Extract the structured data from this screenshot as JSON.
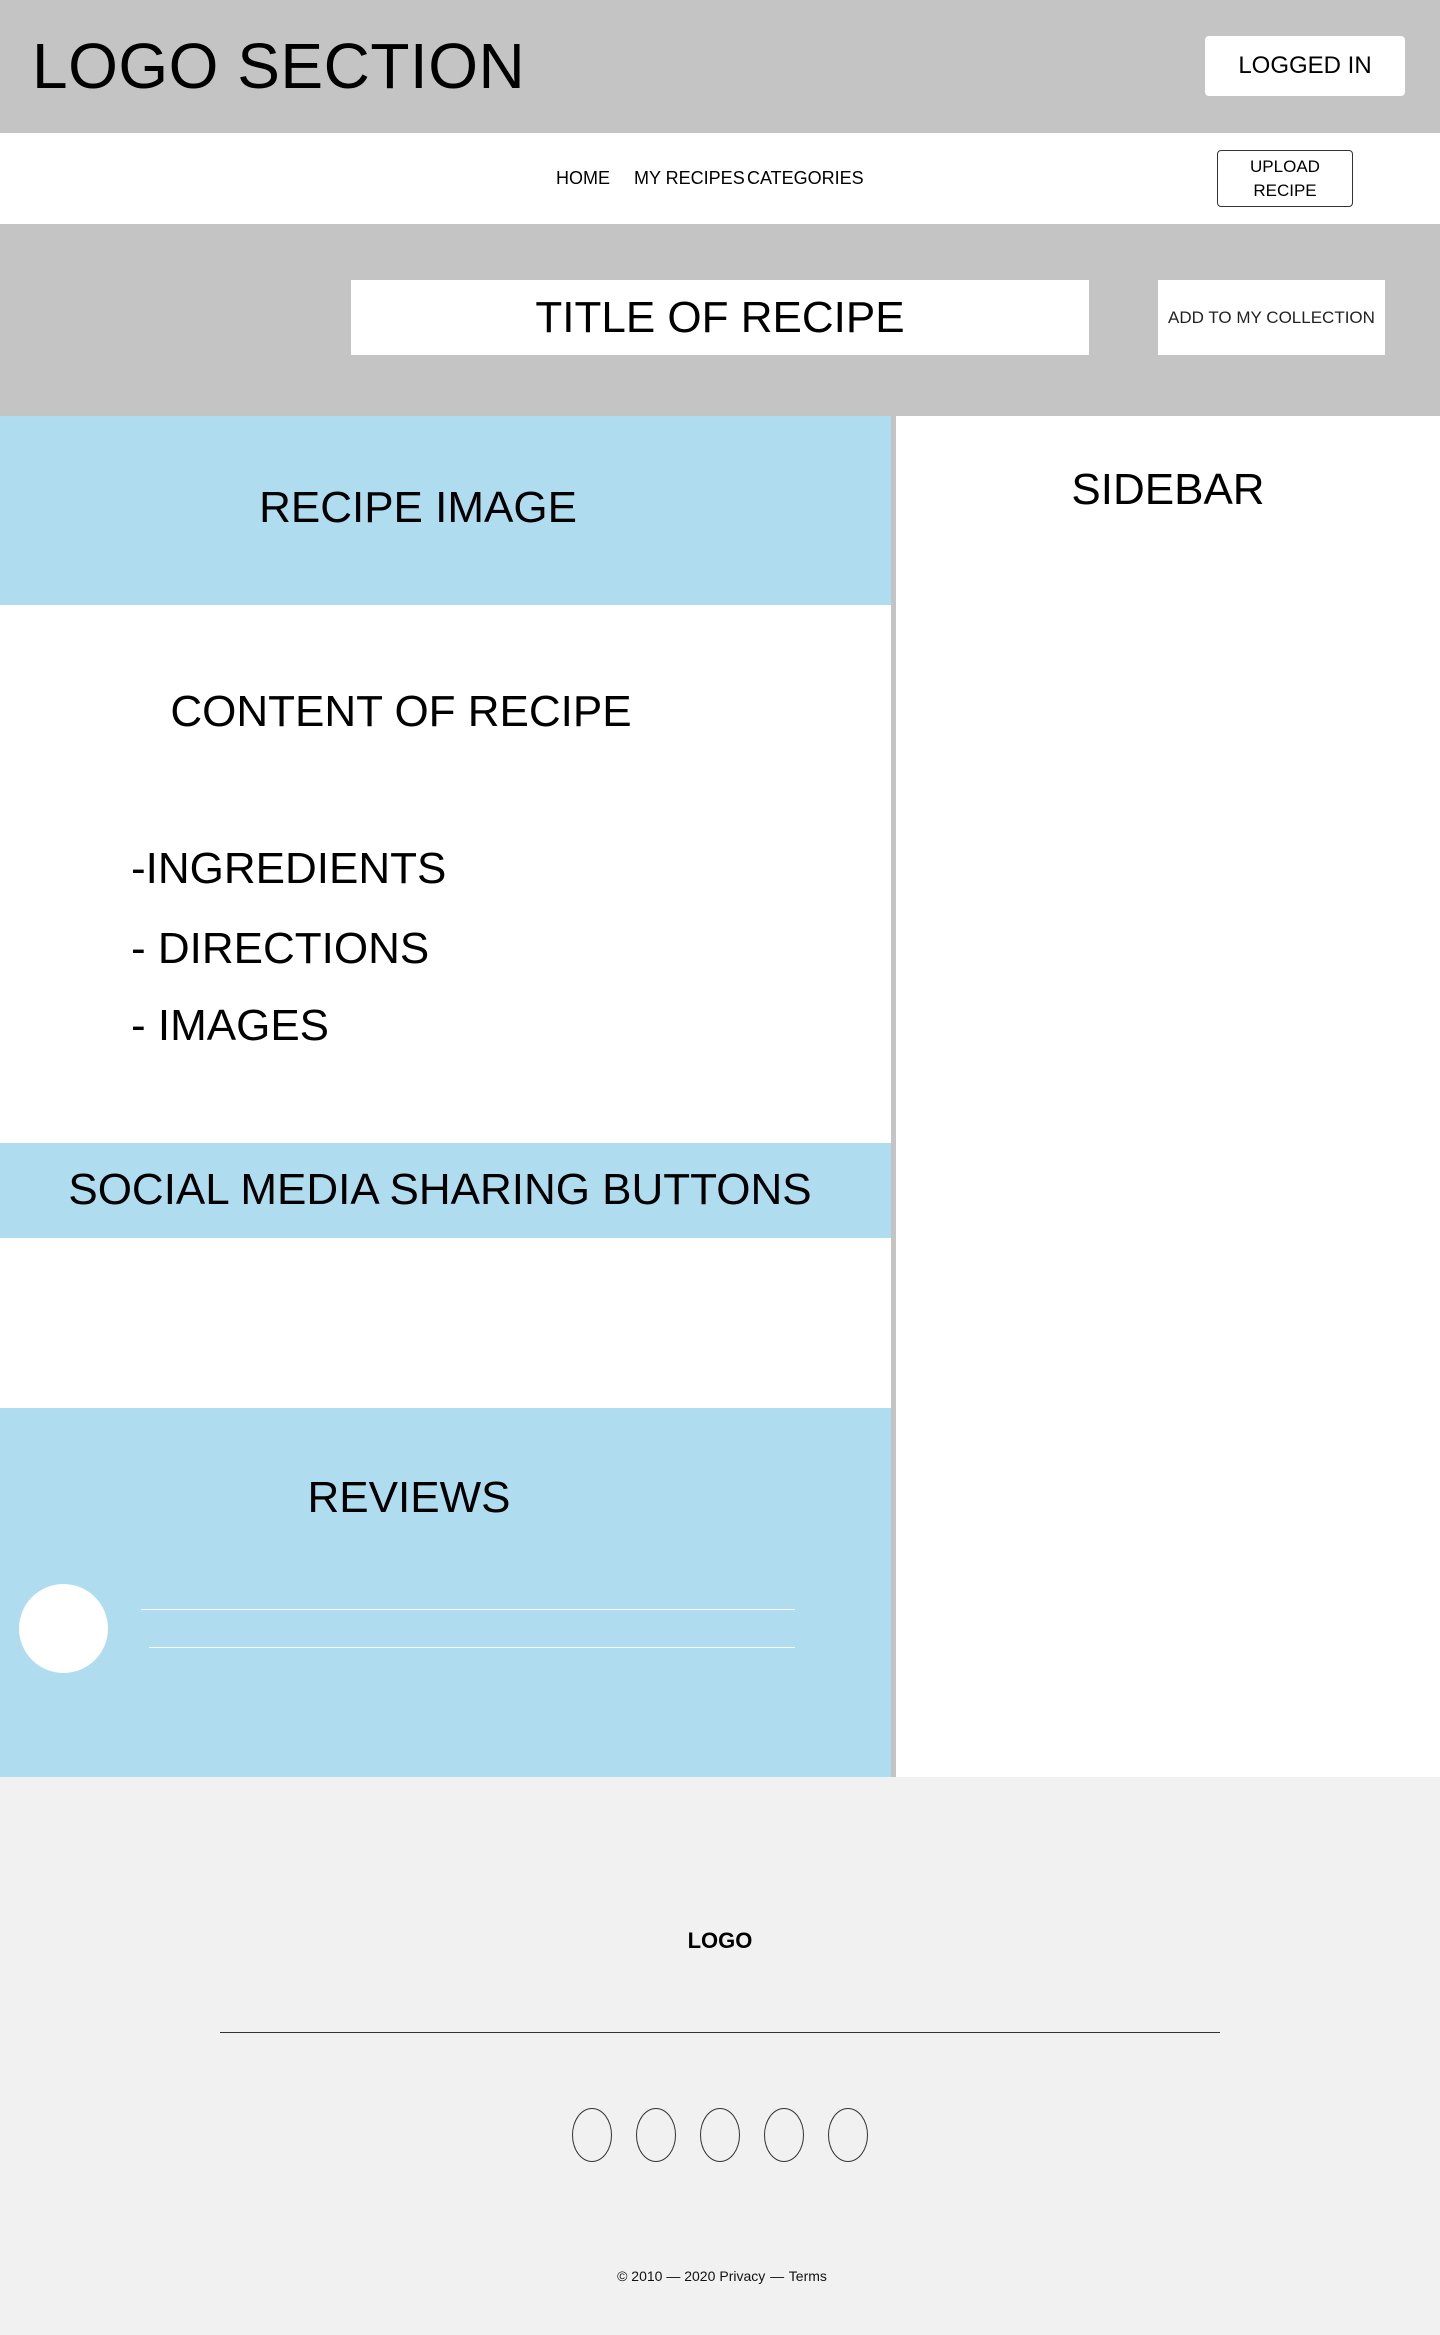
{
  "header": {
    "logo": "LOGO SECTION",
    "logged_in": "LOGGED IN"
  },
  "nav": {
    "items": [
      "HOME",
      "MY RECIPES",
      "CATEGORIES"
    ],
    "upload_line1": "UPLOAD",
    "upload_line2": "RECIPE"
  },
  "title_band": {
    "title": "TITLE OF RECIPE",
    "add_collection": "ADD TO MY COLLECTION"
  },
  "main": {
    "recipe_image": "RECIPE IMAGE",
    "content_title": "CONTENT OF RECIPE",
    "content_items": [
      "-INGREDIENTS",
      "- DIRECTIONS",
      "- IMAGES"
    ],
    "social_sharing": "SOCIAL MEDIA SHARING BUTTONS",
    "reviews_title": "REVIEWS"
  },
  "sidebar": {
    "title": "SIDEBAR"
  },
  "footer": {
    "logo": "LOGO",
    "copyright": "© 2010 — 2020",
    "privacy": "Privacy",
    "separator": "—",
    "terms": "Terms",
    "social_icons": [
      "social-icon-1",
      "social-icon-2",
      "social-icon-3",
      "social-icon-4",
      "social-icon-5"
    ]
  },
  "colors": {
    "header_bg": "#c4c4c4",
    "accent_blue": "#b0dcef",
    "footer_bg": "#f1f1f1"
  }
}
